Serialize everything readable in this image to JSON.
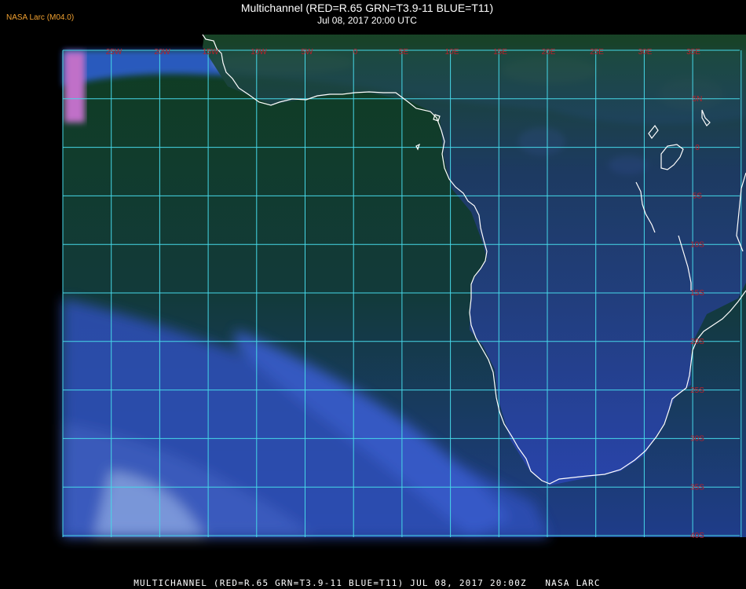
{
  "header": {
    "tag": "NASA Larc (M04.0)",
    "title": "Multichannel (RED=R.65 GRN=T3.9-11 BLUE=T11)",
    "datetime": "Jul 08, 2017 20:00 UTC"
  },
  "footer": {
    "text": "MULTICHANNEL (RED=R.65 GRN=T3.9-11 BLUE=T11) JUL 08, 2017 20:00Z   NASA LARC"
  },
  "map": {
    "longitude_labels": [
      "25W",
      "20W",
      "15W",
      "10W",
      "5W",
      "0",
      "5E",
      "10E",
      "15E",
      "20E",
      "25E",
      "30E",
      "35E"
    ],
    "latitude_labels": [
      "5N",
      "0",
      "5S",
      "10S",
      "15S",
      "20S",
      "25S",
      "30S",
      "35S",
      "40S"
    ],
    "colors": {
      "grid": "#46d8e8",
      "label": "#b8202a",
      "coast": "#ffffff",
      "ocean": "#0f3d26",
      "cloud": "#3a66e6"
    }
  }
}
